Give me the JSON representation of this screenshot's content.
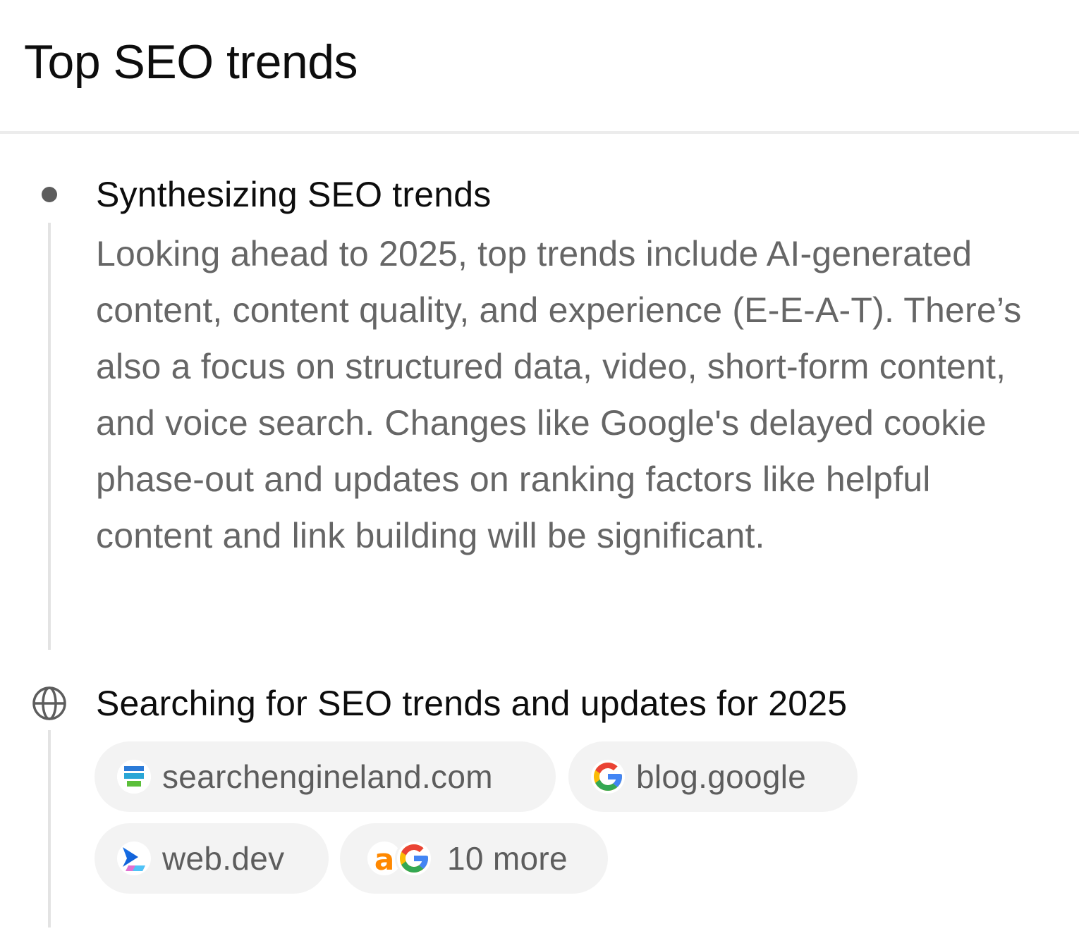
{
  "page": {
    "title": "Top SEO trends"
  },
  "steps": [
    {
      "icon": "dot-icon",
      "title": "Synthesizing SEO trends",
      "body": "Looking ahead to 2025, top trends include AI-generated content, content quality, and experience (E-E-A-T). There’s also a focus on structured data, video, short-form content, and voice search. Changes like Google's delayed cookie phase-out and updates on ranking factors like helpful content and link building will be significant."
    },
    {
      "icon": "globe-icon",
      "title": "Searching for SEO trends and updates for 2025",
      "sources": [
        {
          "label": "searchengineland.com",
          "icon": "search-engine-land-icon"
        },
        {
          "label": "blog.google",
          "icon": "google-icon"
        },
        {
          "label": "web.dev",
          "icon": "web-dev-icon"
        },
        {
          "label": "10 more",
          "icons": [
            "ahrefs-icon",
            "google-icon"
          ]
        }
      ]
    }
  ],
  "colors": {
    "title_text": "#0d0d0d",
    "body_text": "#666666",
    "chip_background": "#f3f3f3",
    "rail": "#e3e3e3",
    "google_blue": "#4285F4",
    "google_red": "#EA4335",
    "google_yellow": "#FBBC05",
    "google_green": "#34A853",
    "ahrefs_orange": "#FF8800"
  }
}
